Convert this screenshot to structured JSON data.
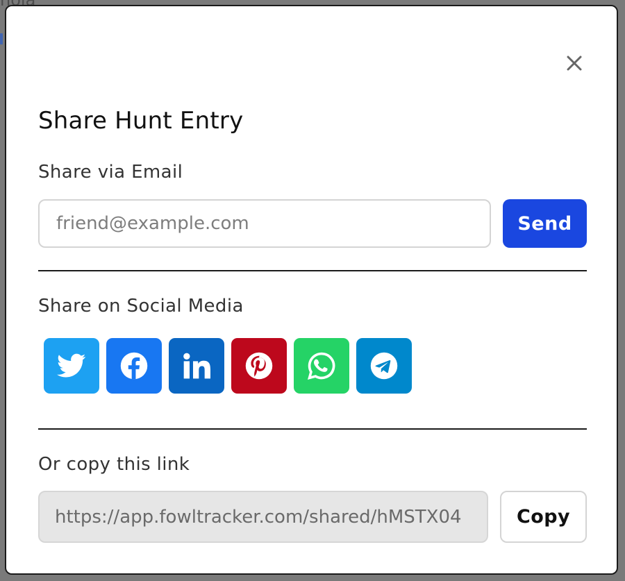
{
  "background": {
    "partial_text": "hola"
  },
  "modal": {
    "title": "Share Hunt Entry",
    "close_icon": "close-icon",
    "email_section": {
      "label": "Share via Email",
      "input_placeholder": "friend@example.com",
      "input_value": "",
      "send_label": "Send",
      "send_color": "#1a47e0"
    },
    "social_section": {
      "label": "Share on Social Media",
      "buttons": [
        {
          "name": "twitter",
          "icon": "twitter-icon",
          "color": "#1da1f2"
        },
        {
          "name": "facebook",
          "icon": "facebook-icon",
          "color": "#1877f2"
        },
        {
          "name": "linkedin",
          "icon": "linkedin-icon",
          "color": "#0a66c2"
        },
        {
          "name": "pinterest",
          "icon": "pinterest-icon",
          "color": "#bd081c"
        },
        {
          "name": "whatsapp",
          "icon": "whatsapp-icon",
          "color": "#25d366"
        },
        {
          "name": "telegram",
          "icon": "telegram-icon",
          "color": "#0088cc"
        }
      ]
    },
    "link_section": {
      "label": "Or copy this link",
      "link_value": "https://app.fowltracker.com/shared/hMSTX04",
      "copy_label": "Copy"
    }
  }
}
